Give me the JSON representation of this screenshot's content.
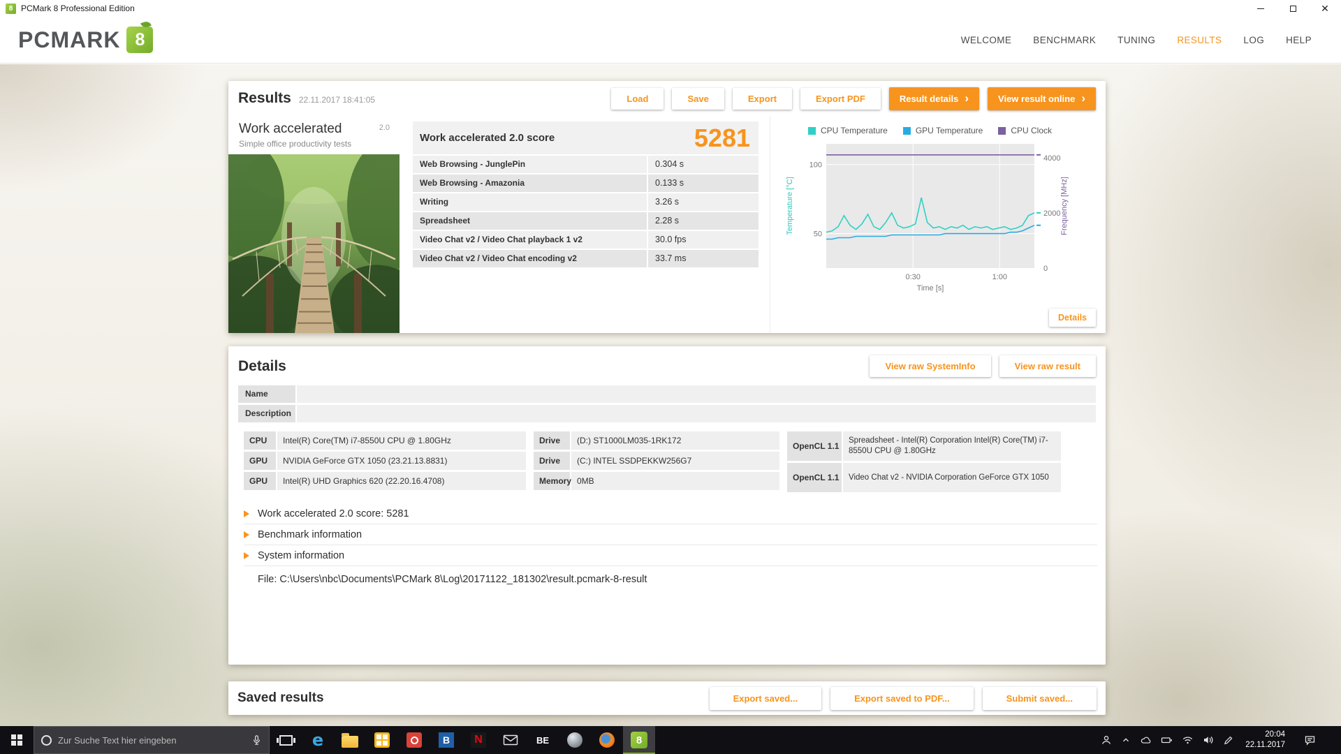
{
  "window": {
    "title": "PCMark 8 Professional Edition"
  },
  "logo": {
    "text": "PCMARK",
    "badge": "8"
  },
  "nav": {
    "items": [
      {
        "label": "WELCOME"
      },
      {
        "label": "BENCHMARK"
      },
      {
        "label": "TUNING"
      },
      {
        "label": "RESULTS"
      },
      {
        "label": "LOG"
      },
      {
        "label": "HELP"
      }
    ],
    "active": "RESULTS"
  },
  "colors": {
    "accent_orange": "#f7941e",
    "brand_green": "#8dc63f"
  },
  "results": {
    "title": "Results",
    "timestamp": "22.11.2017 18:41:05",
    "buttons": {
      "load": "Load",
      "save": "Save",
      "export": "Export",
      "export_pdf": "Export PDF",
      "result_details": "Result details",
      "view_online": "View result online"
    },
    "test": {
      "name": "Work accelerated",
      "version": "2.0",
      "subtitle": "Simple office productivity tests"
    },
    "score": {
      "label": "Work accelerated 2.0 score",
      "value": "5281"
    },
    "metrics": [
      {
        "name": "Web Browsing - JunglePin",
        "value": "0.304 s"
      },
      {
        "name": "Web Browsing - Amazonia",
        "value": "0.133 s"
      },
      {
        "name": "Writing",
        "value": "3.26 s"
      },
      {
        "name": "Spreadsheet",
        "value": "2.28 s"
      },
      {
        "name": "Video Chat v2 / Video Chat playback 1 v2",
        "value": "30.0 fps"
      },
      {
        "name": "Video Chat v2 / Video Chat encoding v2",
        "value": "33.7 ms"
      }
    ],
    "details_button": "Details"
  },
  "chart_data": {
    "type": "line",
    "duration": 72,
    "xlabel": "Time [s]",
    "x_ticks": [
      {
        "t": 30,
        "label": "0:30"
      },
      {
        "t": 60,
        "label": "1:00"
      }
    ],
    "left_label": "Temperature [°C]",
    "left_color": "#2fc6bd",
    "left_range": [
      25,
      115
    ],
    "left_ticks": [
      50,
      100
    ],
    "right_label": "Frequency [MHz]",
    "right_color": "#7d60a0",
    "right_range": [
      0,
      4500
    ],
    "right_ticks": [
      0,
      2000,
      4000
    ],
    "grid": true,
    "legend_position": "top",
    "series": [
      {
        "name": "CPU Temperature",
        "color": "#2fd0c5",
        "axis": "left",
        "values": [
          51,
          52,
          55,
          63,
          56,
          53,
          57,
          64,
          55,
          53,
          58,
          65,
          56,
          54,
          55,
          57,
          76,
          58,
          54,
          55,
          53,
          55,
          54,
          56,
          53,
          55,
          54,
          55,
          53,
          54,
          55,
          53,
          54,
          56,
          63,
          65
        ]
      },
      {
        "name": "GPU Temperature",
        "color": "#29abe2",
        "axis": "left",
        "values": [
          46,
          46,
          47,
          47,
          47,
          48,
          48,
          48,
          48,
          48,
          48,
          49,
          49,
          49,
          49,
          49,
          49,
          49,
          49,
          49,
          50,
          50,
          50,
          50,
          50,
          50,
          50,
          50,
          50,
          50,
          50,
          51,
          51,
          52,
          54,
          56
        ]
      },
      {
        "name": "CPU Clock",
        "color": "#7d60a0",
        "axis": "right",
        "values": [
          4100,
          4100
        ]
      }
    ]
  },
  "details": {
    "title": "Details",
    "buttons": {
      "raw_systeminfo": "View raw SystemInfo",
      "raw_result": "View raw result"
    },
    "fields": [
      {
        "label": "Name",
        "value": ""
      },
      {
        "label": "Description",
        "value": ""
      }
    ],
    "hardware": {
      "col1": [
        {
          "label": "CPU",
          "value": "Intel(R) Core(TM) i7-8550U CPU @ 1.80GHz"
        },
        {
          "label": "GPU",
          "value": "NVIDIA GeForce GTX 1050 (23.21.13.8831)"
        },
        {
          "label": "GPU",
          "value": "Intel(R) UHD Graphics 620 (22.20.16.4708)"
        }
      ],
      "col2": [
        {
          "label": "Drive",
          "value": "(D:) ST1000LM035-1RK172"
        },
        {
          "label": "Drive",
          "value": "(C:) INTEL SSDPEKKW256G7"
        },
        {
          "label": "Memory",
          "value": "0MB"
        }
      ],
      "col3": [
        {
          "label": "OpenCL 1.1",
          "value": "Spreadsheet - Intel(R) Corporation Intel(R) Core(TM) i7-8550U CPU @ 1.80GHz"
        },
        {
          "label": "OpenCL 1.1",
          "value": "Video Chat v2 - NVIDIA Corporation GeForce GTX 1050"
        }
      ]
    },
    "expanders": [
      "Work accelerated 2.0 score: 5281",
      "Benchmark information",
      "System information"
    ],
    "file_path": "File: C:\\Users\\nbc\\Documents\\PCMark 8\\Log\\20171122_181302\\result.pcmark-8-result"
  },
  "saved": {
    "title": "Saved results",
    "buttons": [
      "Export saved...",
      "Export saved to PDF...",
      "Submit saved..."
    ]
  },
  "taskbar": {
    "search_placeholder": "Zur Suche Text hier eingeben",
    "time": "20:04",
    "date": "22.11.2017",
    "edge_glyph": "e",
    "blueb_glyph": "B",
    "netflix_glyph": "N",
    "be_glyph": "BE",
    "pcmark_glyph": "8",
    "app_icons": [
      "task-view",
      "edge",
      "file-explorer",
      "yellow-grid-app",
      "red-app",
      "blue-b-app",
      "netflix",
      "mail",
      "be-app",
      "gray-round-app",
      "browser-round-app",
      "pcmark-8"
    ],
    "tray_icons": [
      "user",
      "chevron-up",
      "cloud",
      "battery",
      "wifi",
      "volume",
      "pen",
      "clock",
      "action-center"
    ]
  }
}
